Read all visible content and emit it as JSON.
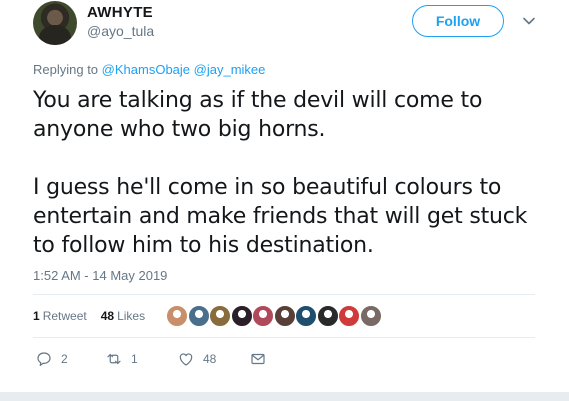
{
  "author": {
    "display_name": "AWHYTE",
    "handle": "@ayo_tula"
  },
  "follow_label": "Follow",
  "reply": {
    "prefix": "Replying to",
    "mentions": [
      "@KhamsObaje",
      "@jay_mikee"
    ]
  },
  "body": {
    "paragraph1": [
      "You are talking as if the devil will come to",
      "anyone who two big horns."
    ],
    "paragraph2": [
      "I guess he'll come in so beautiful colours to",
      "entertain and make friends that will get stuck",
      "to follow him to his destination."
    ]
  },
  "timestamp": "1:52 AM - 14 May 2019",
  "stats": {
    "retweets_count": "1",
    "retweets_label": "Retweet",
    "likes_count": "48",
    "likes_label": "Likes"
  },
  "actions": {
    "reply_count": "2",
    "retweet_count": "1",
    "like_count": "48"
  },
  "liker_avatar_colors": [
    "#c98f6a",
    "#4a6f8c",
    "#8a6b3c",
    "#2b1f2a",
    "#b04a5a",
    "#5a3f38",
    "#1f4f6f",
    "#2a2a2a",
    "#d13a3a",
    "#7a6a66"
  ],
  "colors": {
    "accent": "#1da1f2",
    "secondary_text": "#657786",
    "primary_text": "#14171a"
  }
}
